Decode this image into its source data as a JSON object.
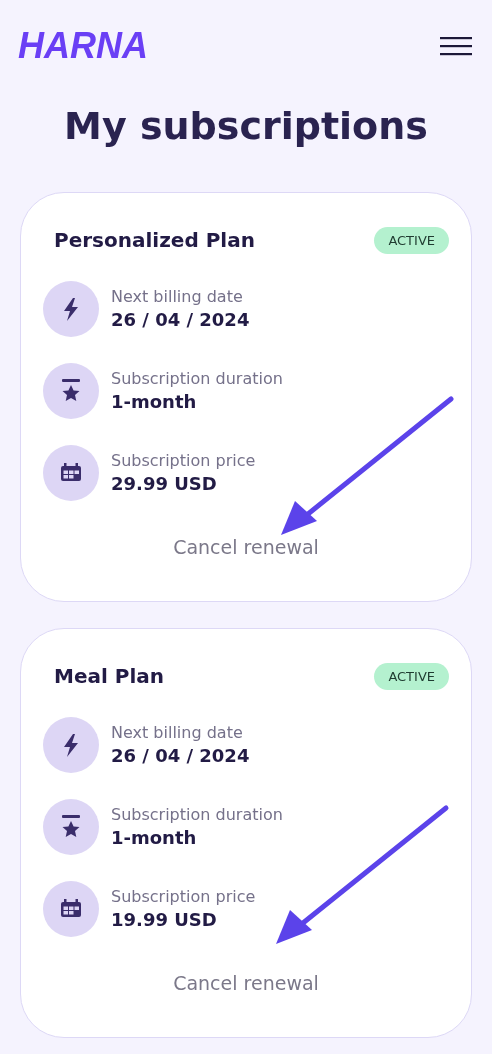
{
  "header": {
    "logo": "HARNA"
  },
  "title": "My subscriptions",
  "subscriptions": [
    {
      "name": "Personalized Plan",
      "status": "ACTIVE",
      "details": [
        {
          "kind": "bolt",
          "label": "Next billing date",
          "value": "26 / 04 / 2024"
        },
        {
          "kind": "award",
          "label": "Subscription duration",
          "value": "1-month"
        },
        {
          "kind": "calendar",
          "label": "Subscription price",
          "value": "29.99 USD"
        }
      ],
      "action": "Cancel renewal"
    },
    {
      "name": "Meal Plan",
      "status": "ACTIVE",
      "details": [
        {
          "kind": "bolt",
          "label": "Next billing date",
          "value": "26 / 04 / 2024"
        },
        {
          "kind": "award",
          "label": "Subscription duration",
          "value": "1-month"
        },
        {
          "kind": "calendar",
          "label": "Subscription price",
          "value": "19.99 USD"
        }
      ],
      "action": "Cancel renewal"
    }
  ]
}
